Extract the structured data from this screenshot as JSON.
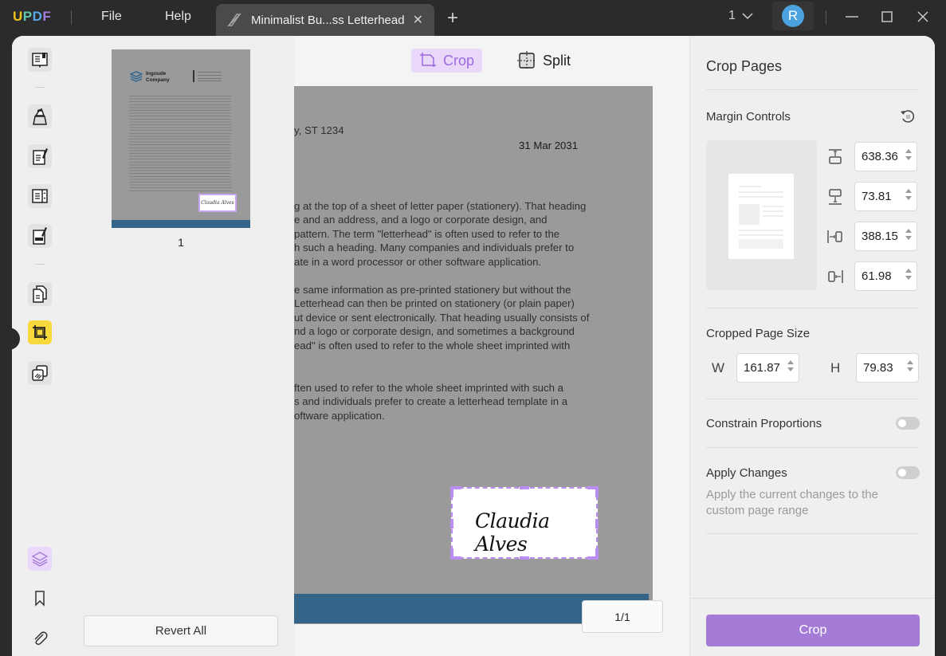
{
  "app": {
    "logo": {
      "u": "U",
      "p": "P",
      "d": "D",
      "f": "F"
    },
    "menu": [
      "File",
      "Help"
    ],
    "tab": {
      "title": "Minimalist Bu...ss Letterhead",
      "icon": "tab-doc-icon",
      "close_icon": "close-icon"
    },
    "new_tab_label": "+",
    "page_selector": {
      "value": "1",
      "icon": "chevron-down-icon"
    },
    "user_avatar": "R",
    "window_controls": [
      "minimize-icon",
      "maximize-icon",
      "close-icon"
    ],
    "colors": {
      "accent": "#a57bd8",
      "titlebar": "#2b2b2b",
      "active_tool": "#f8d93b",
      "doc_footer": "#346487"
    }
  },
  "left_toolbar": {
    "tools": [
      {
        "name": "reader",
        "icon": "book-icon"
      },
      {
        "name": "comment",
        "icon": "highlighter-icon"
      },
      {
        "name": "edit-pdf",
        "icon": "edit-document-icon"
      },
      {
        "name": "form",
        "icon": "form-icon"
      },
      {
        "name": "fill-sign",
        "icon": "sign-document-icon"
      },
      {
        "name": "organize-pages",
        "icon": "pages-icon"
      },
      {
        "name": "crop-pages",
        "icon": "crop-icon",
        "active": true
      },
      {
        "name": "redact",
        "icon": "redact-icon"
      }
    ],
    "bottom_tools": [
      {
        "name": "layers",
        "icon": "layers-icon"
      },
      {
        "name": "bookmark",
        "icon": "bookmark-icon"
      },
      {
        "name": "attachment",
        "icon": "paperclip-icon"
      }
    ]
  },
  "thumbnails": {
    "pages": [
      {
        "number": "1",
        "company_line1": "Ingoude",
        "company_line2": "Company",
        "signature": "Claudia Alves"
      }
    ],
    "revert_all_label": "Revert All"
  },
  "viewer": {
    "mode_tabs": [
      {
        "label": "Crop",
        "icon": "crop-page-icon",
        "active": true
      },
      {
        "label": "Split",
        "icon": "split-icon",
        "active": false
      }
    ],
    "page_text": {
      "address_fragment": "y, ST 1234",
      "date": "31 Mar 2031",
      "para1": [
        "g at the top of a sheet of letter paper (stationery). That heading",
        "e and an address, and a logo or corporate design, and",
        "pattern. The term \"letterhead\" is often used to refer to the",
        "h such a heading. Many companies and individuals prefer to",
        "ate in a word processor or other software application."
      ],
      "para2": [
        "e same information as pre-printed stationery but without the",
        "Letterhead can then be printed on stationery (or plain paper)",
        "ut device or sent electronically. That heading usually consists of",
        "nd a logo or corporate design, and sometimes a background",
        "ead\" is often used to refer to the whole sheet imprinted with"
      ],
      "para3": [
        "ften used to refer to the whole sheet imprinted with such a",
        "s and individuals prefer to create a letterhead template in a",
        "oftware application."
      ],
      "signature": "Claudia Alves"
    },
    "pager": "1/1"
  },
  "crop_panel": {
    "title": "Crop Pages",
    "margin_controls": {
      "label": "Margin Controls",
      "reset_icon": "reset-icon",
      "fields": [
        {
          "name": "top",
          "icon": "margin-top-icon",
          "value": "638.36"
        },
        {
          "name": "bottom",
          "icon": "margin-bottom-icon",
          "value": "73.81"
        },
        {
          "name": "left",
          "icon": "margin-left-icon",
          "value": "388.15"
        },
        {
          "name": "right",
          "icon": "margin-right-icon",
          "value": "61.98"
        }
      ]
    },
    "cropped_size": {
      "label": "Cropped Page Size",
      "width_label": "W",
      "width_value": "161.87",
      "height_label": "H",
      "height_value": "79.83"
    },
    "constrain": {
      "label": "Constrain Proportions",
      "on": false
    },
    "apply": {
      "label": "Apply Changes",
      "description": "Apply the current changes to the custom page range",
      "on": false
    },
    "crop_button": "Crop"
  }
}
